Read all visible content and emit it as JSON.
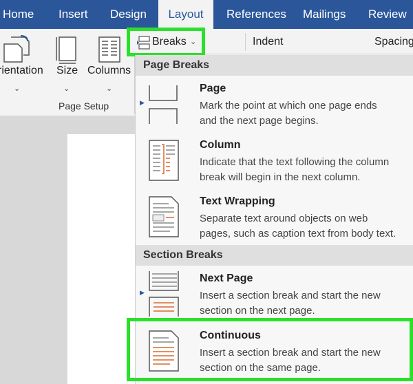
{
  "tabs": [
    "Home",
    "Insert",
    "Design",
    "Layout",
    "References",
    "Mailings",
    "Review"
  ],
  "active_tab": "Layout",
  "ribbon": {
    "orientation_label": "rientation",
    "size_label": "Size",
    "columns_label": "Columns",
    "group_label": "Page Setup",
    "breaks_label": "Breaks",
    "indent_label": "Indent",
    "spacing_label": "Spacing"
  },
  "breaks_menu": {
    "page_breaks_header": "Page Breaks",
    "section_breaks_header": "Section Breaks",
    "page": {
      "title": "Page",
      "desc1": "Mark the point at which one page ends",
      "desc2": "and the next page begins."
    },
    "column": {
      "title": "Column",
      "desc1": "Indicate that the text following the column",
      "desc2": "break will begin in the next column."
    },
    "text_wrapping": {
      "title": "Text Wrapping",
      "desc1": "Separate text around objects on web",
      "desc2": "pages, such as caption text from body text."
    },
    "next_page": {
      "title": "Next Page",
      "desc1": "Insert a section break and start the new",
      "desc2": "section on the next page."
    },
    "continuous": {
      "title": "Continuous",
      "desc1": "Insert a section break and start the new",
      "desc2": "section on the same page."
    }
  },
  "colors": {
    "tab_bar": "#2b579a",
    "highlight": "#2be02b",
    "icon_accent": "#d86a2e"
  }
}
